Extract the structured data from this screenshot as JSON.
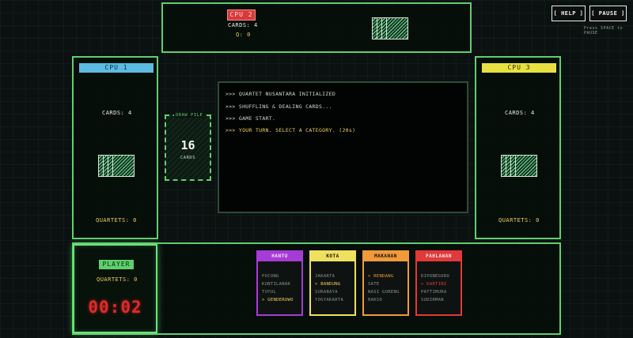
{
  "top_bar": {
    "help_label": "[ HELP ]",
    "pause_label": "[ PAUSE ]",
    "pause_hint": "Press SPACE to PAUSE"
  },
  "cpu2": {
    "name": "CPU 2",
    "cards": "CARDS: 4",
    "quartets": "Q: 0",
    "color": "#d83a3a"
  },
  "cpu1": {
    "name": "CPU 1",
    "cards": "CARDS: 4",
    "quartets": "QUARTETS: 0",
    "color": "#5bbbe0"
  },
  "cpu3": {
    "name": "CPU 3",
    "cards": "CARDS: 4",
    "quartets": "QUARTETS: 0",
    "color": "#e8e040"
  },
  "draw_pile": {
    "label": "DRAW PILE",
    "count": "16",
    "unit": "CARDS"
  },
  "log": {
    "lines": [
      ">>> QUARTET NUSANTARA INITIALIZED",
      ">>> SHUFFLING & DEALING CARDS...",
      ">>> GAME START.",
      ">>> YOUR TURN. SELECT A CATEGORY. (20s)"
    ]
  },
  "player": {
    "name": "PLAYER",
    "quartets": "QUARTETS: 0",
    "timer": "00:02",
    "timer_color": "#e02a2a"
  },
  "hand": [
    {
      "title": "HANTU",
      "color": "#a73bd6",
      "items": [
        "POCONG",
        "KUNTILANAK",
        "TUYUL",
        "> GENDERUWO"
      ],
      "highlight": 3
    },
    {
      "title": "KOTA",
      "color": "#f0e060",
      "items": [
        "JAKARTA",
        "> BANDUNG",
        "SURABAYA",
        "YOGYAKARTA"
      ],
      "highlight": 1
    },
    {
      "title": "MAKANAN",
      "color": "#f09a3a",
      "items": [
        "> RENDANG",
        "SATE",
        "NASI GORENG",
        "BAKSO"
      ],
      "highlight": 0
    },
    {
      "title": "PAHLAWAN",
      "color": "#e03a3a",
      "items": [
        "DIPONEGORO",
        "> KARTINI",
        "PATTIMURA",
        "SUDIRMAN"
      ],
      "highlight": 1
    }
  ]
}
